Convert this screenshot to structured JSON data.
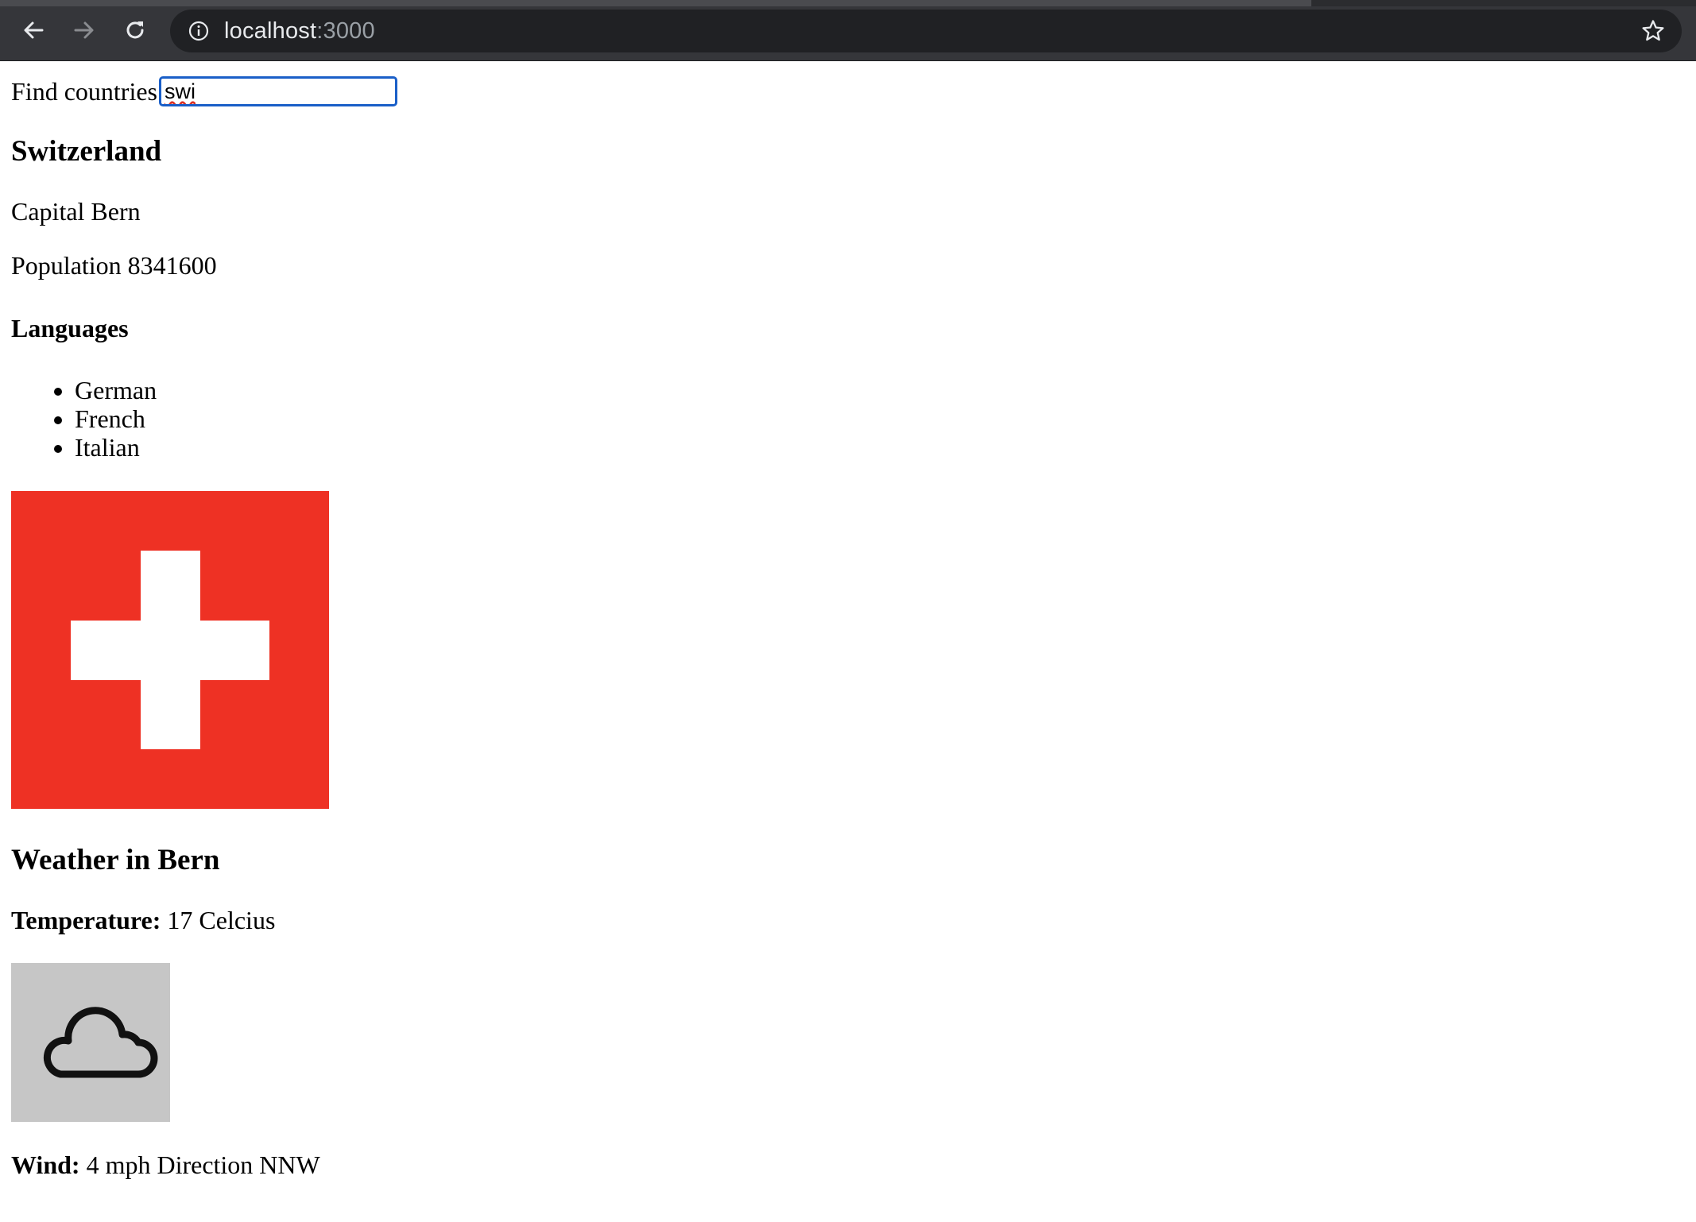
{
  "browser": {
    "url_host": "localhost",
    "url_port": ":3000"
  },
  "search": {
    "label": "Find countries",
    "value": "swi"
  },
  "country": {
    "name": "Switzerland",
    "capital_label": "Capital",
    "capital": "Bern",
    "population_label": "Population",
    "population": "8341600",
    "languages_title": "Languages",
    "languages": [
      "German",
      "French",
      "Italian"
    ],
    "flag_colors": {
      "background": "#ee3124",
      "cross": "#ffffff"
    }
  },
  "weather": {
    "title": "Weather in Bern",
    "temperature_label": "Temperature:",
    "temperature": "17 Celcius",
    "icon": "cloud-icon",
    "wind_label": "Wind:",
    "wind": "4 mph Direction NNW"
  },
  "colors": {
    "toolbar": "#35363a",
    "omnibox": "#202124",
    "focus_ring": "#1a5fc8"
  }
}
